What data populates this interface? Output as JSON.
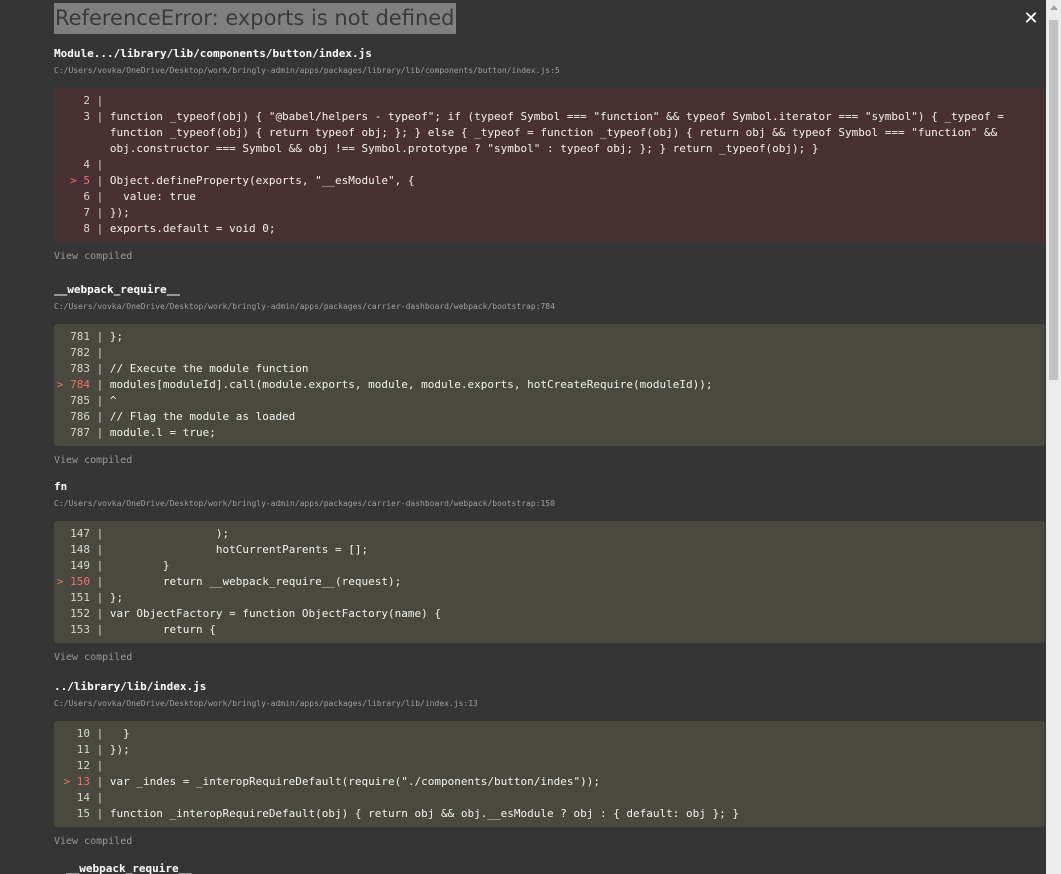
{
  "header": {
    "title": "ReferenceError: exports is not defined",
    "close_glyph": "✕"
  },
  "frames": [
    {
      "name": "Module.../library/lib/components/button/index.js",
      "path": "C:/Users/vovka/OneDrive/Desktop/work/bringly-admin/apps/packages/library/lib/components/button/index.js:5",
      "variant": "error",
      "lines": [
        {
          "num": "2",
          "marker": "",
          "code": ""
        },
        {
          "num": "3",
          "marker": "",
          "code": "function _typeof(obj) { \"@babel/helpers - typeof\"; if (typeof Symbol === \"function\" && typeof Symbol.iterator === \"symbol\") { _typeof = function _typeof(obj) { return typeof obj; }; } else { _typeof = function _typeof(obj) { return obj && typeof Symbol === \"function\" && obj.constructor === Symbol && obj !== Symbol.prototype ? \"symbol\" : typeof obj; }; } return _typeof(obj); }"
        },
        {
          "num": "4",
          "marker": "",
          "code": ""
        },
        {
          "num": "5",
          "marker": ">",
          "code": "Object.defineProperty(exports, \"__esModule\", {"
        },
        {
          "num": "6",
          "marker": "",
          "code": "  value: true"
        },
        {
          "num": "7",
          "marker": "",
          "code": "});"
        },
        {
          "num": "8",
          "marker": "",
          "code": "exports.default = void 0;"
        }
      ],
      "view_compiled": "View compiled"
    },
    {
      "name": "__webpack_require__",
      "path": "C:/Users/vovka/OneDrive/Desktop/work/bringly-admin/apps/packages/carrier-dashboard/webpack/bootstrap:784",
      "variant": "normal",
      "lines": [
        {
          "num": "781",
          "marker": "",
          "code": "};"
        },
        {
          "num": "782",
          "marker": "",
          "code": ""
        },
        {
          "num": "783",
          "marker": "",
          "code": "// Execute the module function"
        },
        {
          "num": "784",
          "marker": ">",
          "code": "modules[moduleId].call(module.exports, module, module.exports, hotCreateRequire(moduleId));"
        },
        {
          "num": "785",
          "marker": "",
          "code": "^"
        },
        {
          "num": "786",
          "marker": "",
          "code": "// Flag the module as loaded"
        },
        {
          "num": "787",
          "marker": "",
          "code": "module.l = true;"
        }
      ],
      "view_compiled": "View compiled"
    },
    {
      "name": "fn",
      "path": "C:/Users/vovka/OneDrive/Desktop/work/bringly-admin/apps/packages/carrier-dashboard/webpack/bootstrap:150",
      "variant": "normal",
      "lines": [
        {
          "num": "147",
          "marker": "",
          "code": "                );"
        },
        {
          "num": "148",
          "marker": "",
          "code": "                hotCurrentParents = [];"
        },
        {
          "num": "149",
          "marker": "",
          "code": "        }"
        },
        {
          "num": "150",
          "marker": ">",
          "code": "        return __webpack_require__(request);"
        },
        {
          "num": "151",
          "marker": "",
          "code": "};"
        },
        {
          "num": "152",
          "marker": "",
          "code": "var ObjectFactory = function ObjectFactory(name) {"
        },
        {
          "num": "153",
          "marker": "",
          "code": "        return {"
        }
      ],
      "view_compiled": "View compiled"
    },
    {
      "name": "../library/lib/index.js",
      "path": "C:/Users/vovka/OneDrive/Desktop/work/bringly-admin/apps/packages/library/lib/index.js:13",
      "variant": "normal",
      "lines": [
        {
          "num": "10",
          "marker": "",
          "code": "  }"
        },
        {
          "num": "11",
          "marker": "",
          "code": "});"
        },
        {
          "num": "12",
          "marker": "",
          "code": ""
        },
        {
          "num": "13",
          "marker": ">",
          "code": "var _indes = _interopRequireDefault(require(\"./components/button/indes\"));"
        },
        {
          "num": "14",
          "marker": "",
          "code": ""
        },
        {
          "num": "15",
          "marker": "",
          "code": "function _interopRequireDefault(obj) { return obj && obj.__esModule ? obj : { default: obj }; }"
        }
      ],
      "view_compiled": "View compiled"
    }
  ],
  "partial_frame_name": "__webpack_require__",
  "colors": {
    "background": "#353535",
    "error_code_bg": "#483033",
    "normal_code_bg": "#494940",
    "marker": "#f07070"
  }
}
